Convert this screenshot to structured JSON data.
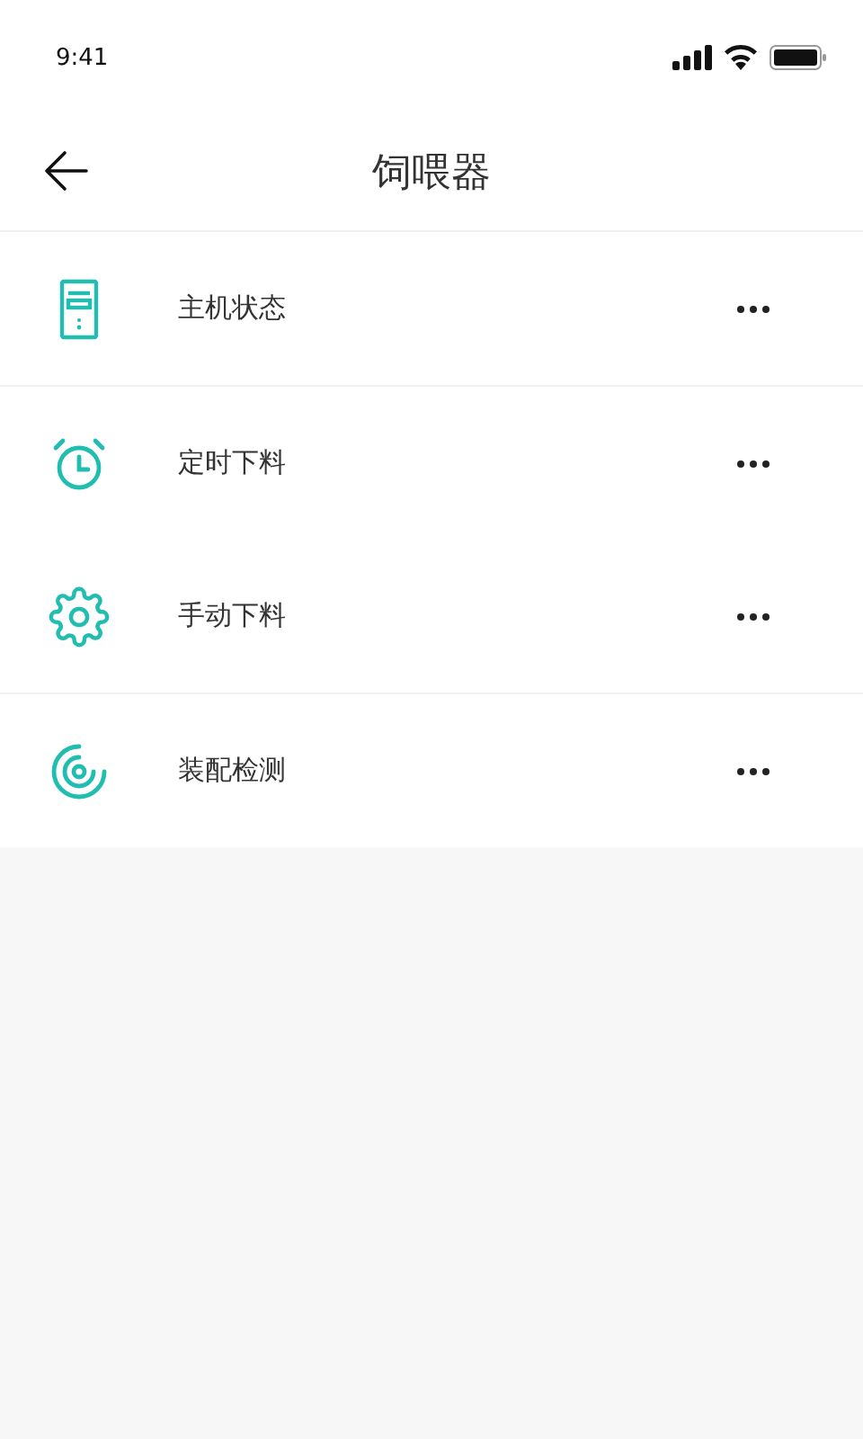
{
  "status_bar": {
    "time": "9:41"
  },
  "header": {
    "title": "饲喂器"
  },
  "menu": [
    {
      "kind": "device",
      "label": "主机状态",
      "divider": true
    },
    {
      "kind": "alarm",
      "label": "定时下料",
      "divider": false
    },
    {
      "kind": "gear",
      "label": "手动下料",
      "divider": true
    },
    {
      "kind": "radar",
      "label": "装配检测",
      "divider": false
    }
  ]
}
